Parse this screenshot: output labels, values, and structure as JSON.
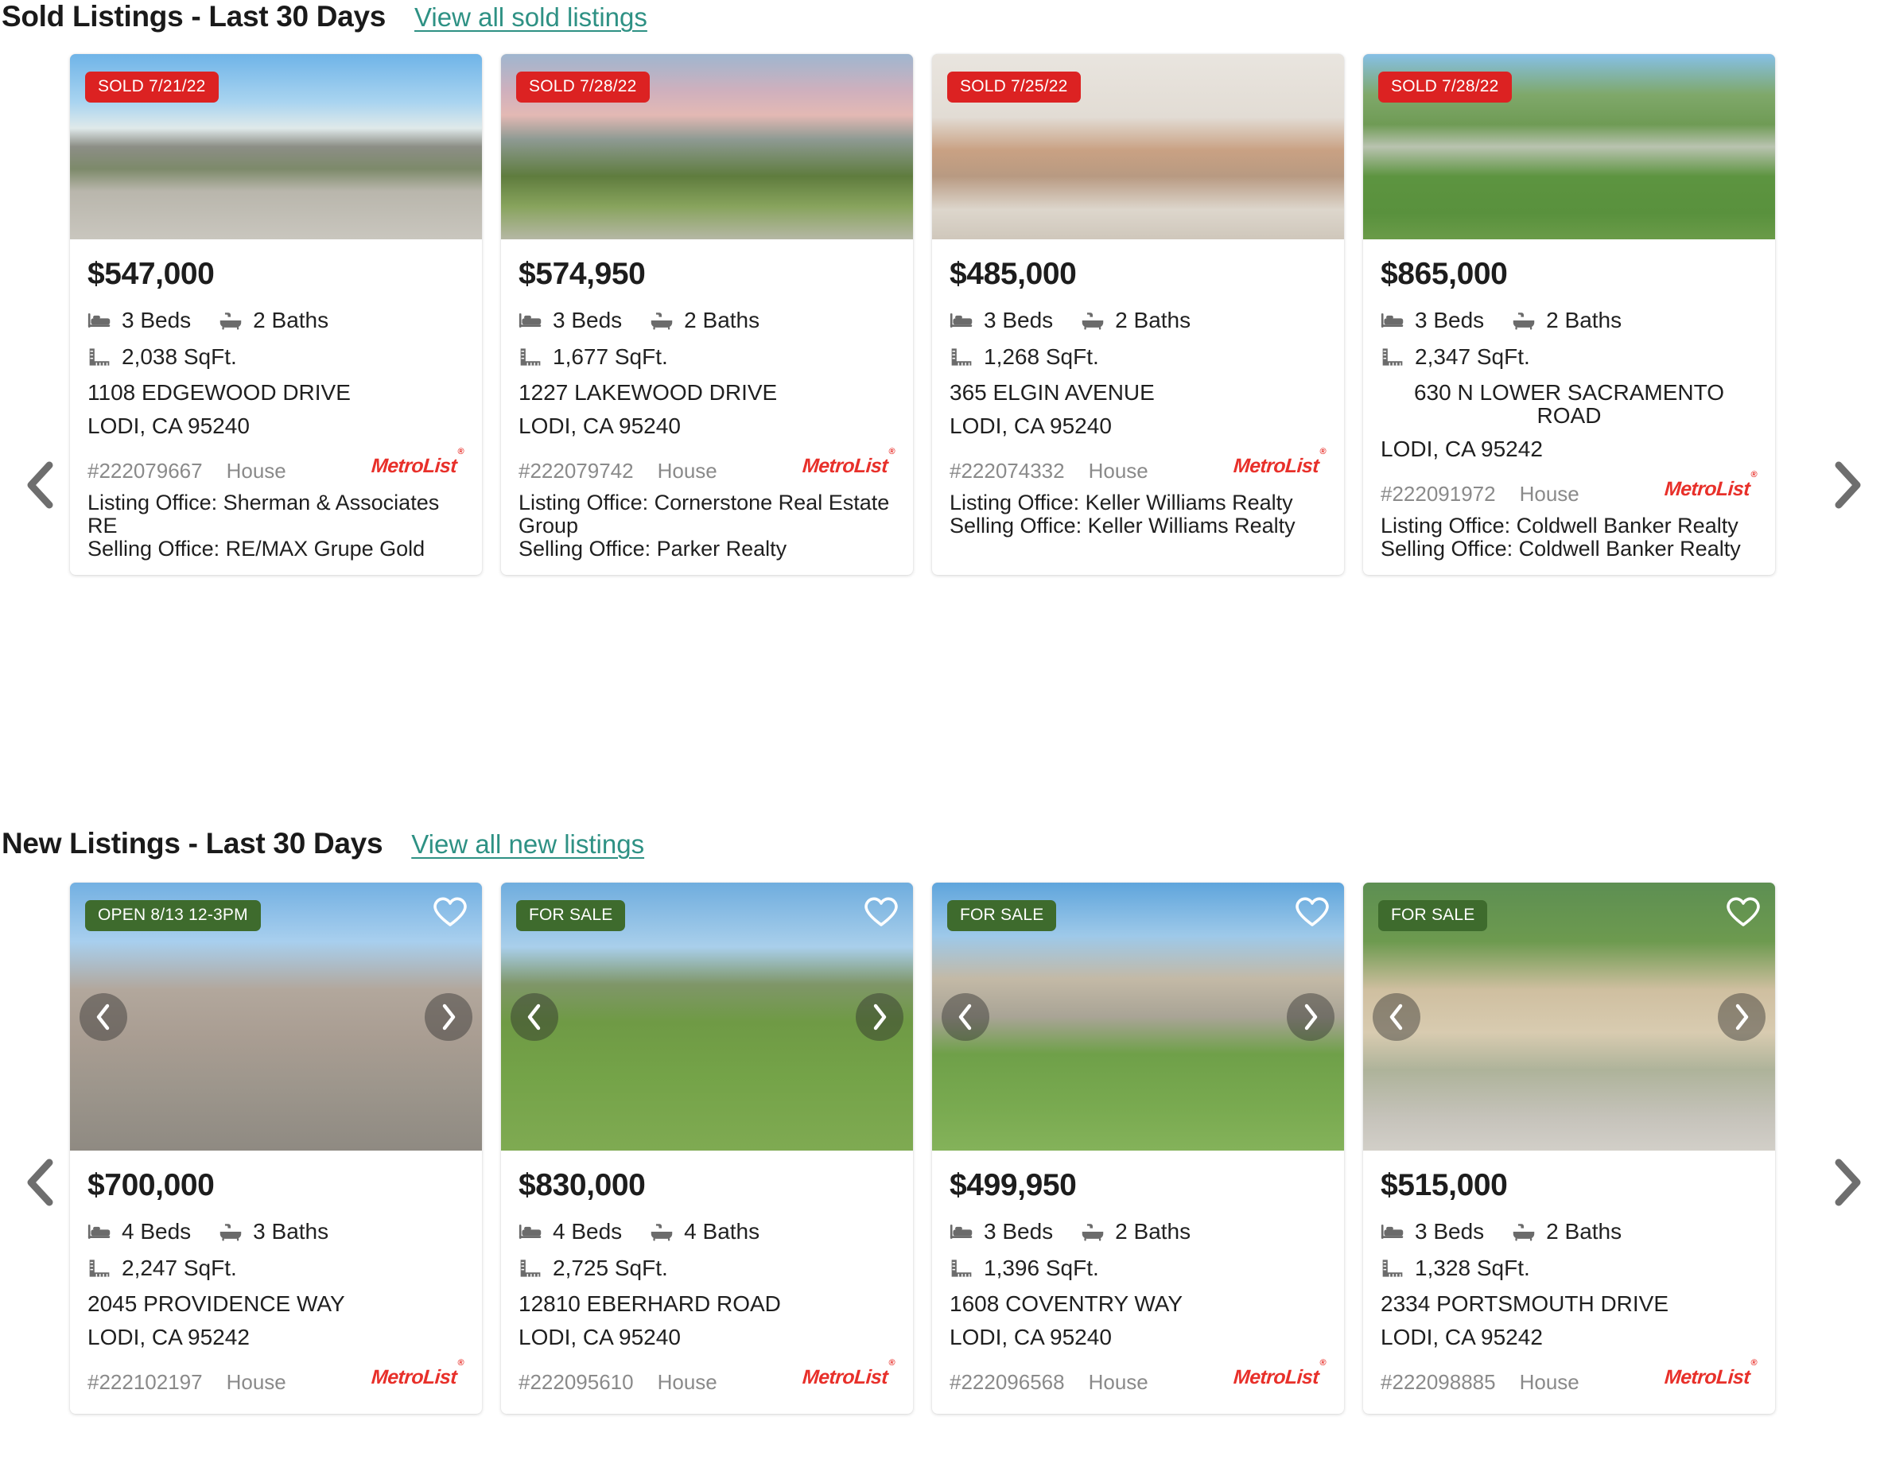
{
  "brand": {
    "link_color": "#2e9184",
    "sold_badge_color": "#dc2222",
    "status_badge_color": "#3e6b2d",
    "metrolist_color": "#e8302a",
    "metrolist_label": "MetroList",
    "metrolist_mark": "®"
  },
  "sold_section": {
    "title": "Sold Listings - Last 30 Days",
    "link_label": "View all sold listings",
    "prev_label": "‹",
    "next_label": "›",
    "cards": [
      {
        "badge": "SOLD 7/21/22",
        "price": "$547,000",
        "beds": "3 Beds",
        "baths": "2 Baths",
        "sqft": "2,038 SqFt.",
        "address_line1": "1108 EDGEWOOD DRIVE",
        "address_line2": "LODI, CA 95240",
        "address_centered": false,
        "mls": "#222079667",
        "property_type": "House",
        "listing_office": "Listing Office: Sherman & Associates RE",
        "selling_office": "Selling Office: RE/MAX Grupe Gold",
        "photo": "exterior-ranch-house-driveway"
      },
      {
        "badge": "SOLD 7/28/22",
        "price": "$574,950",
        "beds": "3 Beds",
        "baths": "2 Baths",
        "sqft": "1,677 SqFt.",
        "address_line1": "1227 LAKEWOOD DRIVE",
        "address_line2": "LODI, CA 95240",
        "address_centered": false,
        "mls": "#222079742",
        "property_type": "House",
        "listing_office": "Listing Office: Cornerstone Real Estate Group",
        "selling_office": "Selling Office: Parker Realty",
        "photo": "exterior-house-sunset-lawn"
      },
      {
        "badge": "SOLD 7/25/22",
        "price": "$485,000",
        "beds": "3 Beds",
        "baths": "2 Baths",
        "sqft": "1,268 SqFt.",
        "address_line1": "365 ELGIN AVENUE",
        "address_line2": "LODI, CA 95240",
        "address_centered": false,
        "mls": "#222074332",
        "property_type": "House",
        "listing_office": "Listing Office: Keller Williams Realty",
        "selling_office": "Selling Office: Keller Williams Realty",
        "photo": "interior-living-room-fireplace"
      },
      {
        "badge": "SOLD 7/28/22",
        "price": "$865,000",
        "beds": "3 Beds",
        "baths": "2 Baths",
        "sqft": "2,347 SqFt.",
        "address_line1": "630 N LOWER SACRAMENTO ROAD",
        "address_line2": "LODI, CA 95242",
        "address_centered": true,
        "mls": "#222091972",
        "property_type": "House",
        "listing_office": "Listing Office: Coldwell Banker Realty",
        "selling_office": "Selling Office: Coldwell Banker Realty",
        "photo": "exterior-house-trees-green-lawn"
      }
    ]
  },
  "new_section": {
    "title": "New Listings - Last 30 Days",
    "link_label": "View all new listings",
    "prev_label": "‹",
    "next_label": "›",
    "cards": [
      {
        "badge": "OPEN 8/13 12-3PM",
        "badge_kind": "status",
        "price": "$700,000",
        "beds": "4 Beds",
        "baths": "3 Baths",
        "sqft": "2,247 SqFt.",
        "address_line1": "2045 PROVIDENCE WAY",
        "address_line2": "LODI, CA 95242",
        "address_centered": false,
        "mls": "#222102197",
        "property_type": "House",
        "photo": "exterior-stucco-tile-roof-house"
      },
      {
        "badge": "FOR SALE",
        "badge_kind": "status",
        "price": "$830,000",
        "beds": "4 Beds",
        "baths": "4 Baths",
        "sqft": "2,725 SqFt.",
        "address_line1": "12810 EBERHARD ROAD",
        "address_line2": "LODI, CA 95240",
        "address_centered": false,
        "mls": "#222095610",
        "property_type": "House",
        "photo": "exterior-ranch-house-large-lawn"
      },
      {
        "badge": "FOR SALE",
        "badge_kind": "status",
        "price": "$499,950",
        "beds": "3 Beds",
        "baths": "2 Baths",
        "sqft": "1,396 SqFt.",
        "address_line1": "1608 COVENTRY WAY",
        "address_line2": "LODI, CA 95240",
        "address_centered": false,
        "mls": "#222096568",
        "property_type": "House",
        "photo": "exterior-two-story-house-lawn"
      },
      {
        "badge": "FOR SALE",
        "badge_kind": "status",
        "price": "$515,000",
        "beds": "3 Beds",
        "baths": "2 Baths",
        "sqft": "1,328 SqFt.",
        "address_line1": "2334 PORTSMOUTH DRIVE",
        "address_line2": "LODI, CA 95242",
        "address_centered": false,
        "mls": "#222098885",
        "property_type": "House",
        "photo": "exterior-house-shade-tree-driveway"
      }
    ]
  },
  "icons": {
    "bed": "bed-icon",
    "bath": "bath-icon",
    "ruler": "ruler-icon",
    "heart": "heart-icon",
    "chevron_left": "chevron-left-icon",
    "chevron_right": "chevron-right-icon"
  }
}
